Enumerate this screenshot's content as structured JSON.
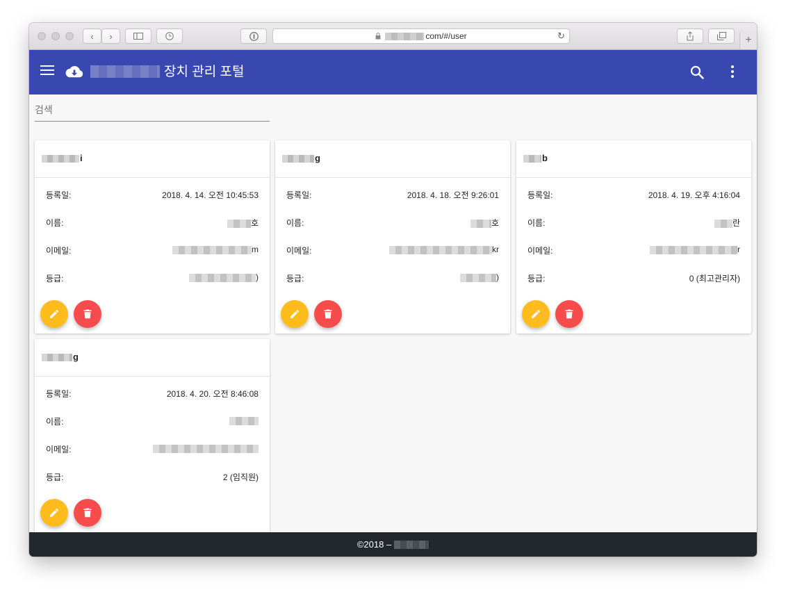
{
  "browser": {
    "url_visible": "com/#/user",
    "new_tab_label": "+"
  },
  "appbar": {
    "title": "장치 관리 포털",
    "icons": [
      "menu-icon",
      "cloud-download-icon",
      "search-icon",
      "more-vert-icon"
    ]
  },
  "search": {
    "placeholder": "검색"
  },
  "field_labels": {
    "registered": "등록일:",
    "name": "이름:",
    "email": "이메일:",
    "grade": "등급:"
  },
  "users": [
    {
      "title_visible": "i",
      "registered": "2018. 4. 14. 오전 10:45:53",
      "name_visible": "호",
      "email_visible": "m",
      "grade_visible": ")"
    },
    {
      "title_visible": "g",
      "registered": "2018. 4. 18. 오전 9:26:01",
      "name_visible": "호",
      "email_visible": "kr",
      "grade_visible": ")"
    },
    {
      "title_visible": "b",
      "registered": "2018. 4. 19. 오후 4:16:04",
      "name_visible": "란",
      "email_visible": "r",
      "grade_visible": "0 (최고관리자)"
    },
    {
      "title_visible": "g",
      "registered": "2018. 4. 20. 오전 8:46:08",
      "name_visible": "",
      "email_visible": "",
      "grade_visible": "2 (임직원)"
    }
  ],
  "footer": {
    "text": "©2018 –"
  },
  "colors": {
    "appbar": "#3848b0",
    "edit_fab": "#ffbc1c",
    "delete_fab": "#f74c4c",
    "footer": "#23282d",
    "background": "#f7f7f7"
  }
}
